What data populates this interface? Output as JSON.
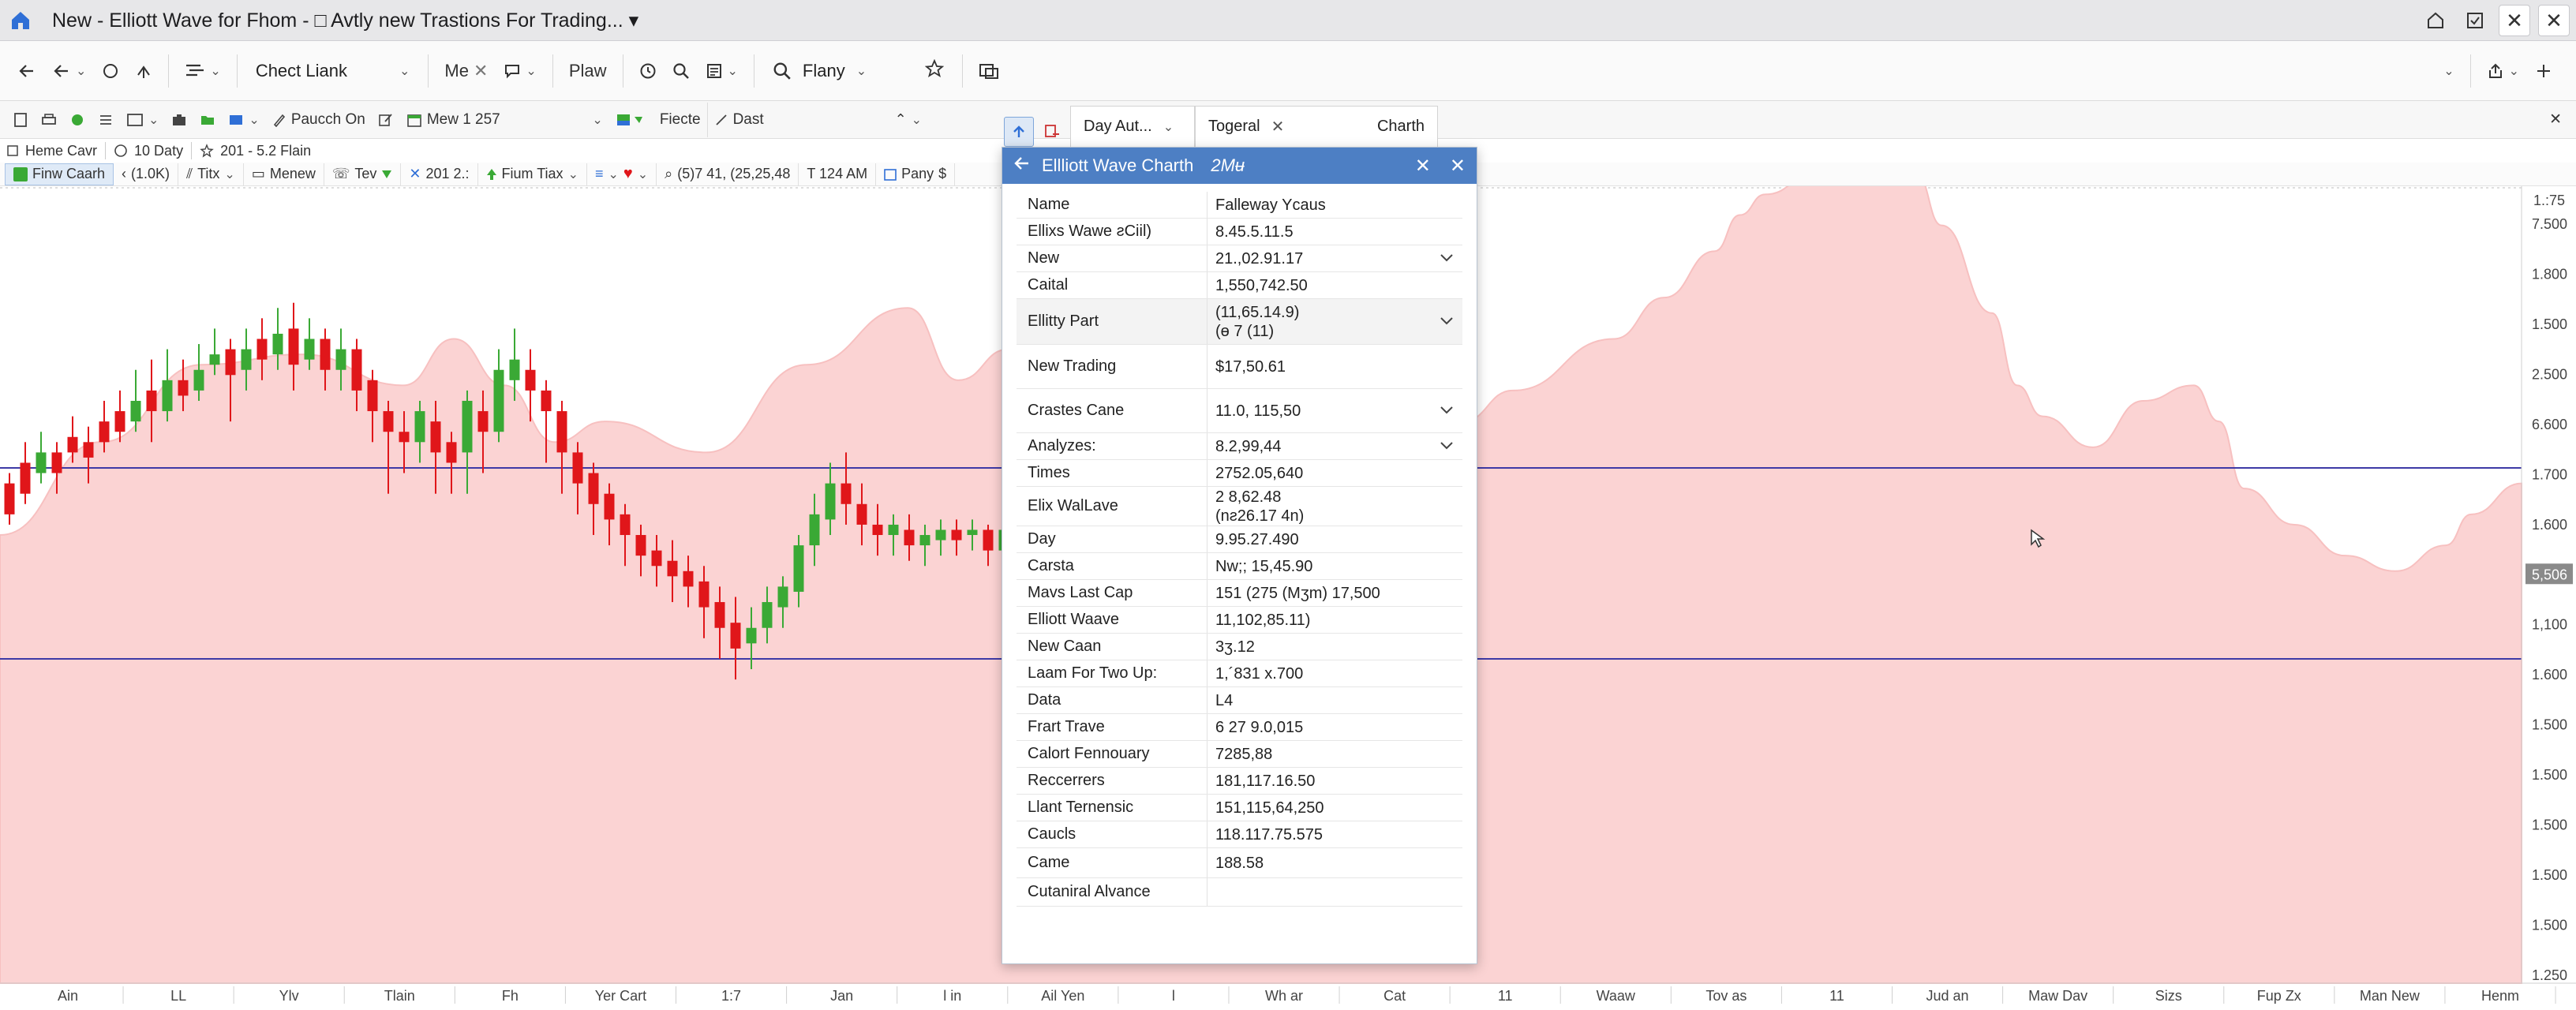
{
  "window": {
    "title": "New - Elliott Wave for Fhom - □ Avtly new Trastions For Trading... ▾",
    "colors": {
      "titlebar": "#e7e7e9",
      "accent": "#4d7fc4",
      "up_candle": "#3aa935",
      "down_candle": "#e0161a",
      "area_fill": "#fbd3d3",
      "baseline": "#3e3aa6"
    }
  },
  "toolbar1": {
    "check_link": "Chect Liank",
    "me": "Me",
    "plaw": "Plaw",
    "search_value": "Flany"
  },
  "toolbar2": {
    "pauch": "Paucch On",
    "mew": "Mew 1 257",
    "fiecte": "Fiecte",
    "dast": "Dast"
  },
  "toolbar3": {
    "home": "Heme Cavr",
    "days": "10 Daty",
    "range": "201 - 5.2 Flain"
  },
  "toolbar4": {
    "chart": "Finw Caarh",
    "count": "(1.0K)",
    "titx": "Titx",
    "menew": "Menew",
    "tev": "Tev",
    "num": "201 2.:",
    "fiumtiax": "Fium Tiax",
    "coords": "(5)7 41, (25,25,48",
    "time": "T 124 AM",
    "pany": "Pany",
    "dollar": "$"
  },
  "floating_tabs": {
    "day_auto": "Day Aut...",
    "togeral": "Togeral",
    "charth": "Charth"
  },
  "dialog": {
    "title": "Ellliott Wave Charth",
    "title_suffix": "2Mʉ",
    "rows": [
      {
        "key": "Name",
        "value": "Falleway Ycaus",
        "chevron": false,
        "shade": false,
        "h": 34
      },
      {
        "key": "Ellixs Wawe ƨCiil)",
        "value": "8.45.5.11.5",
        "chevron": false,
        "shade": false,
        "h": 34
      },
      {
        "key": "New",
        "value": "21.,02.91.17",
        "chevron": true,
        "shade": false,
        "h": 34
      },
      {
        "key": "Caital",
        "value": "1,550,742.50",
        "chevron": false,
        "shade": false,
        "h": 34
      },
      {
        "key": "Ellitty Part",
        "value": "(11,65.14.9)\n(ɵ 7 (11)",
        "chevron": true,
        "shade": true,
        "h": 58
      },
      {
        "key": "New Trading",
        "value": "$17,50.61",
        "chevron": false,
        "shade": false,
        "h": 56
      },
      {
        "key": "Crastes Cane",
        "value": "11.0, 115,50",
        "chevron": true,
        "shade": false,
        "h": 56
      },
      {
        "key": "Analyzes:",
        "value": "8.2,99,44",
        "chevron": true,
        "shade": false,
        "h": 34
      },
      {
        "key": "Times",
        "value": "2752.05,640",
        "chevron": false,
        "shade": false,
        "h": 34
      },
      {
        "key": "Elix WalLave",
        "value": "2 8,62.48\n(nƨ26.17 4n)",
        "chevron": false,
        "shade": false,
        "h": 50
      },
      {
        "key": "Day",
        "value": "9.95.27.490",
        "chevron": false,
        "shade": false,
        "h": 34
      },
      {
        "key": "Carsta",
        "value": "Nw;; 15,45.90",
        "chevron": false,
        "shade": false,
        "h": 34
      },
      {
        "key": "Mavs Last Cap",
        "value": "151 (275 (Mʒm) 17,500",
        "chevron": false,
        "shade": false,
        "h": 34
      },
      {
        "key": "Elliott Waave",
        "value": "11,102,85.11)",
        "chevron": false,
        "shade": false,
        "h": 34
      },
      {
        "key": "New Caan",
        "value": "3ʒ.12",
        "chevron": false,
        "shade": false,
        "h": 34
      },
      {
        "key": "Laam For Two Up:",
        "value": "1,´831 x.700",
        "chevron": false,
        "shade": false,
        "h": 34
      },
      {
        "key": "Data",
        "value": "L4",
        "chevron": false,
        "shade": false,
        "h": 34
      },
      {
        "key": "Frart Trave",
        "value": "6 27 9.0,015",
        "chevron": false,
        "shade": false,
        "h": 34
      },
      {
        "key": "Calort Fennouary",
        "value": "7285,88",
        "chevron": false,
        "shade": false,
        "h": 34
      },
      {
        "key": "Reccerrers",
        "value": "181,117.16.50",
        "chevron": false,
        "shade": false,
        "h": 34
      },
      {
        "key": "Llant Ternensic",
        "value": "151,115,64,250",
        "chevron": false,
        "shade": false,
        "h": 34
      },
      {
        "key": "Caucls",
        "value": "118.117.75.575",
        "chevron": false,
        "shade": false,
        "h": 34
      },
      {
        "key": "Came",
        "value": "188.58",
        "chevron": false,
        "shade": false,
        "h": 38
      },
      {
        "key": "Cutaniral Alvance",
        "value": "",
        "chevron": false,
        "shade": false,
        "h": 36
      }
    ]
  },
  "chart_data": {
    "type": "line",
    "title": "",
    "xlabel": "",
    "ylabel": "",
    "top_right_label": "1.:75",
    "x_ticks": [
      "Ain",
      "LL",
      "Ylv",
      "Tlain",
      "Fh",
      "Yer Cart",
      "1:7",
      "Jan",
      "l in",
      "Ail Yen",
      "l",
      "Wh ar",
      "Cat",
      "11",
      "Waaw",
      "Tov as",
      "11",
      "Jud an",
      "Maw Dav",
      "Sizs",
      "Fup Zx",
      "Man New",
      "Henm"
    ],
    "y_ticks": [
      "7.500",
      "1.800",
      "1.500",
      "2.500",
      "6.600",
      "1.700",
      "1.600",
      "5,506",
      "1,100",
      "1.600",
      "1.500",
      "1.500",
      "1.500",
      "1.500",
      "1.500",
      "1.250"
    ],
    "highlighted_y_tick": "5,506",
    "ylim": [
      0,
      100
    ],
    "area": {
      "x": [
        0,
        4,
        8,
        12,
        16,
        18,
        20,
        22,
        24,
        28,
        32,
        36,
        38,
        40,
        42,
        44,
        48,
        52,
        54,
        58,
        60,
        64,
        66,
        68,
        69,
        70,
        72,
        74,
        76,
        77,
        79,
        80,
        81,
        83,
        85,
        87,
        88,
        89,
        91,
        93,
        95,
        97,
        98,
        100
      ],
      "y": [
        12,
        30,
        45,
        47,
        41,
        50,
        41,
        30,
        34,
        28,
        45,
        56,
        42,
        48,
        30,
        21,
        14,
        21,
        14,
        34,
        40,
        50,
        58,
        67,
        74,
        78,
        82,
        84,
        82,
        72,
        55,
        41,
        35,
        29,
        38,
        41,
        34,
        21,
        14,
        8,
        5,
        10,
        16,
        22
      ]
    },
    "baselines": [
      25,
      -12
    ],
    "candles": [
      [
        22,
        16,
        14,
        24
      ],
      [
        26,
        20,
        18,
        30
      ],
      [
        24,
        28,
        22,
        32
      ],
      [
        28,
        24,
        20,
        30
      ],
      [
        31,
        28,
        26,
        35
      ],
      [
        30,
        27,
        22,
        33
      ],
      [
        34,
        30,
        28,
        38
      ],
      [
        36,
        32,
        30,
        40
      ],
      [
        34,
        38,
        32,
        44
      ],
      [
        40,
        36,
        30,
        46
      ],
      [
        36,
        42,
        34,
        48
      ],
      [
        42,
        39,
        36,
        46
      ],
      [
        40,
        44,
        38,
        49
      ],
      [
        45,
        47,
        43,
        52
      ],
      [
        48,
        43,
        34,
        50
      ],
      [
        44,
        48,
        40,
        52
      ],
      [
        50,
        46,
        42,
        54
      ],
      [
        47,
        51,
        44,
        56
      ],
      [
        52,
        45,
        40,
        57
      ],
      [
        46,
        50,
        44,
        54
      ],
      [
        50,
        44,
        40,
        52
      ],
      [
        44,
        48,
        40,
        52
      ],
      [
        48,
        40,
        36,
        50
      ],
      [
        42,
        36,
        30,
        44
      ],
      [
        36,
        32,
        20,
        38
      ],
      [
        32,
        30,
        24,
        36
      ],
      [
        30,
        36,
        26,
        38
      ],
      [
        34,
        28,
        20,
        38
      ],
      [
        30,
        26,
        20,
        32
      ],
      [
        28,
        38,
        20,
        40
      ],
      [
        36,
        32,
        24,
        40
      ],
      [
        32,
        44,
        30,
        48
      ],
      [
        42,
        46,
        38,
        52
      ],
      [
        44,
        40,
        34,
        48
      ],
      [
        40,
        36,
        26,
        42
      ],
      [
        36,
        28,
        20,
        38
      ],
      [
        28,
        22,
        16,
        30
      ],
      [
        24,
        18,
        12,
        26
      ],
      [
        20,
        15,
        10,
        22
      ],
      [
        16,
        12,
        6,
        18
      ],
      [
        12,
        8,
        4,
        14
      ],
      [
        9,
        6,
        2,
        12
      ],
      [
        7,
        4,
        -1,
        11
      ],
      [
        5,
        2,
        -2,
        8
      ],
      [
        3,
        -2,
        -8,
        6
      ],
      [
        -1,
        -6,
        -12,
        2
      ],
      [
        -5,
        -10,
        -16,
        0
      ],
      [
        -9,
        -6,
        -14,
        -2
      ],
      [
        -6,
        -1,
        -9,
        2
      ],
      [
        -2,
        2,
        -6,
        4
      ],
      [
        1,
        10,
        -2,
        12
      ],
      [
        10,
        16,
        6,
        20
      ],
      [
        15,
        22,
        12,
        26
      ],
      [
        22,
        18,
        14,
        28
      ],
      [
        18,
        14,
        10,
        22
      ],
      [
        14,
        12,
        8,
        18
      ],
      [
        12,
        14,
        8,
        16
      ],
      [
        13,
        10,
        7,
        16
      ],
      [
        10,
        12,
        6,
        14
      ],
      [
        11,
        13,
        8,
        15
      ],
      [
        13,
        11,
        8,
        15
      ],
      [
        12,
        13,
        9,
        15
      ],
      [
        13,
        9,
        6,
        14
      ],
      [
        9,
        13,
        6,
        14
      ]
    ]
  }
}
